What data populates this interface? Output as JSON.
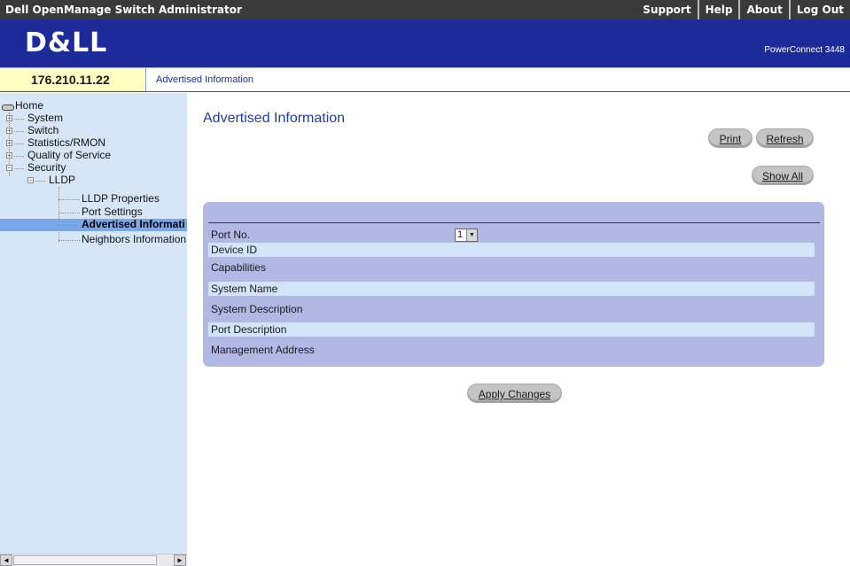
{
  "app": {
    "title": "Dell OpenManage Switch Administrator",
    "logo_text": "D&LL",
    "model": "PowerConnect 3448"
  },
  "topnav": [
    "Support",
    "Help",
    "About",
    "Log Out"
  ],
  "address": {
    "ip": "176.210.11.22",
    "breadcrumb": "Advertised Information"
  },
  "sidebar": {
    "home": "Home",
    "items": [
      {
        "label": "System"
      },
      {
        "label": "Switch"
      },
      {
        "label": "Statistics/RMON"
      },
      {
        "label": "Quality of Service"
      },
      {
        "label": "Security"
      },
      {
        "label": "LLDP"
      },
      {
        "label": "LLDP Properties"
      },
      {
        "label": "Port Settings"
      },
      {
        "label": "Advertised Informati",
        "selected": true
      },
      {
        "label": "Neighbors Information"
      }
    ]
  },
  "main": {
    "title": "Advertised Information",
    "buttons": {
      "print": "Print",
      "refresh": "Refresh",
      "show_all": "Show All",
      "apply": "Apply Changes"
    },
    "form": {
      "fields": [
        {
          "label": "Port No."
        },
        {
          "label": "Device ID"
        },
        {
          "label": "Capabilities"
        },
        {
          "label": "System Name"
        },
        {
          "label": "System Description"
        },
        {
          "label": "Port Description"
        },
        {
          "label": "Management Address"
        }
      ],
      "port_select_value": "1"
    }
  },
  "colors": {
    "banner": "#1d2b9a",
    "sidebar": "#d6e6f6",
    "panel": "#b2b8e4",
    "title_text": "#1f3ea8"
  }
}
